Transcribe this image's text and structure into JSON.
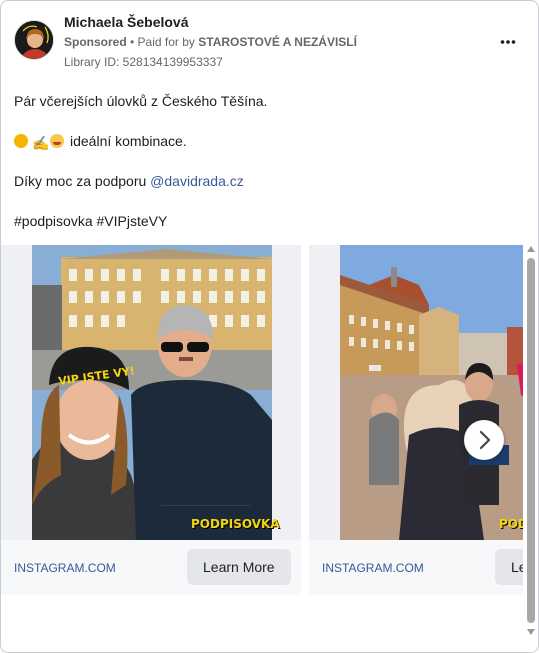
{
  "ad": {
    "advertiser_name": "Michaela Šebelová",
    "sponsored_label": "Sponsored",
    "paid_for_by_prefix": "• Paid for by",
    "paid_for_by": "STAROSTOVÉ A NEZÁVISLÍ",
    "library_id": "Library ID: 528134139953337",
    "more_options_icon": "more-horizontal-icon"
  },
  "post": {
    "line1": "Pár včerejších úlovků z Českého Těšína.",
    "line2_text": "ideální kombinace.",
    "line2_emojis": [
      "sun-emoji",
      "writing-hand-emoji",
      "smiling-face-emoji"
    ],
    "line3_prefix": "Díky moc za podporu ",
    "line3_mention": "@davidrada.cz",
    "line4": "#podpisovka #VIPjsteVY"
  },
  "carousel": {
    "cards": [
      {
        "domain": "INSTAGRAM.COM",
        "cta": "Learn More",
        "image_description_icon": "photo-selfie-icon",
        "hat_text": "VIP JSTE VY!",
        "overlay_text": "PODPISOVKA"
      },
      {
        "domain": "INSTAGRAM.COM",
        "cta": "Learn More",
        "image_description_icon": "photo-street-icon",
        "overlay_text": "PODPISOVKA"
      }
    ],
    "next_icon": "chevron-right-icon"
  },
  "colors": {
    "link": "#385898",
    "secondary_text": "#65676b",
    "button_bg": "#e4e6eb",
    "podpisovka_yellow": "#f4d60e"
  }
}
